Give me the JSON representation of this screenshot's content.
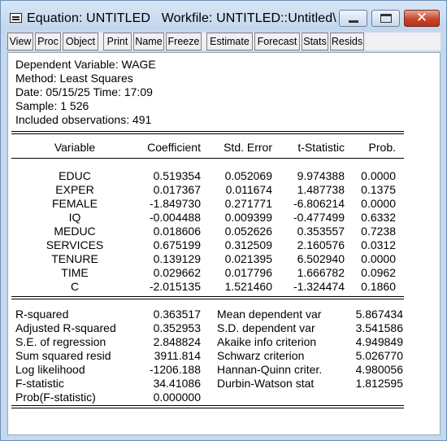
{
  "window": {
    "title": "Equation: UNTITLED   Workfile: UNTITLED::Untitled\\",
    "minimize_icon": "minimize-icon",
    "maximize_icon": "maximize-icon",
    "close_icon": "close-icon",
    "close_glyph": "✕"
  },
  "toolbar": {
    "buttons": [
      "View",
      "Proc",
      "Object",
      "Print",
      "Name",
      "Freeze",
      "Estimate",
      "Forecast",
      "Stats",
      "Resids"
    ]
  },
  "header": {
    "dependent": "Dependent Variable: WAGE",
    "method": "Method: Least Squares",
    "date": "Date: 05/15/25   Time: 17:09",
    "sample": "Sample: 1 526",
    "observations": "Included observations: 491"
  },
  "table": {
    "columns": [
      "Variable",
      "Coefficient",
      "Std. Error",
      "t-Statistic",
      "Prob."
    ],
    "rows": [
      {
        "variable": "EDUC",
        "coefficient": "0.519354",
        "std_error": "0.052069",
        "t_stat": "9.974388",
        "prob": "0.0000"
      },
      {
        "variable": "EXPER",
        "coefficient": "0.017367",
        "std_error": "0.011674",
        "t_stat": "1.487738",
        "prob": "0.1375"
      },
      {
        "variable": "FEMALE",
        "coefficient": "-1.849730",
        "std_error": "0.271771",
        "t_stat": "-6.806214",
        "prob": "0.0000"
      },
      {
        "variable": "IQ",
        "coefficient": "-0.004488",
        "std_error": "0.009399",
        "t_stat": "-0.477499",
        "prob": "0.6332"
      },
      {
        "variable": "MEDUC",
        "coefficient": "0.018606",
        "std_error": "0.052626",
        "t_stat": "0.353557",
        "prob": "0.7238"
      },
      {
        "variable": "SERVICES",
        "coefficient": "0.675199",
        "std_error": "0.312509",
        "t_stat": "2.160576",
        "prob": "0.0312"
      },
      {
        "variable": "TENURE",
        "coefficient": "0.139129",
        "std_error": "0.021395",
        "t_stat": "6.502940",
        "prob": "0.0000"
      },
      {
        "variable": "TIME",
        "coefficient": "0.029662",
        "std_error": "0.017796",
        "t_stat": "1.666782",
        "prob": "0.0962"
      },
      {
        "variable": "C",
        "coefficient": "-2.015135",
        "std_error": "1.521460",
        "t_stat": "-1.324474",
        "prob": "0.1860"
      }
    ]
  },
  "stats": {
    "left": [
      {
        "label": "R-squared",
        "value": "0.363517"
      },
      {
        "label": "Adjusted R-squared",
        "value": "0.352953"
      },
      {
        "label": "S.E. of regression",
        "value": "2.848824"
      },
      {
        "label": "Sum squared resid",
        "value": "3911.814"
      },
      {
        "label": "Log likelihood",
        "value": "-1206.188"
      },
      {
        "label": "F-statistic",
        "value": "34.41086"
      },
      {
        "label": "Prob(F-statistic)",
        "value": "0.000000"
      }
    ],
    "right": [
      {
        "label": "Mean dependent var",
        "value": "5.867434"
      },
      {
        "label": "S.D. dependent var",
        "value": "3.541586"
      },
      {
        "label": "Akaike info criterion",
        "value": "4.949849"
      },
      {
        "label": "Schwarz criterion",
        "value": "5.026770"
      },
      {
        "label": "Hannan-Quinn criter.",
        "value": "4.980056"
      },
      {
        "label": "Durbin-Watson stat",
        "value": "1.812595"
      }
    ]
  }
}
